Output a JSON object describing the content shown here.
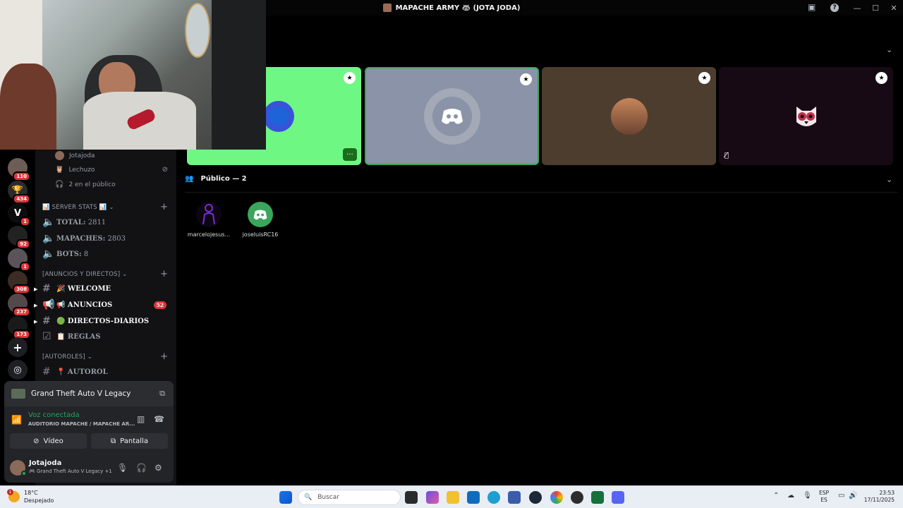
{
  "window": {
    "title": "MAPACHE ARMY 🦝 (JOTA JODA)",
    "minimize": "—",
    "maximize": "☐",
    "close": "✕",
    "help": "?",
    "inbox": "▣"
  },
  "servers": [
    {
      "name": "server-1",
      "badge": "110",
      "color": "#6d5d55"
    },
    {
      "name": "server-2",
      "badge": "434",
      "color": "#2b2b2b"
    },
    {
      "name": "server-3",
      "badge": "1",
      "color": "#0d0d0d",
      "glyph": "V"
    },
    {
      "name": "server-4",
      "badge": "92",
      "color": "#222"
    },
    {
      "name": "server-5",
      "badge": "1",
      "color": "#5a5458"
    },
    {
      "name": "server-6",
      "badge": "308",
      "color": "#3b2d23"
    },
    {
      "name": "server-7",
      "badge": "237",
      "color": "#54494a"
    },
    {
      "name": "server-8",
      "badge": "173",
      "color": "#1a1a1a"
    }
  ],
  "rail_actions": {
    "add": "+",
    "discover": "◎"
  },
  "voice_users": [
    {
      "name": "Jotajoda"
    },
    {
      "name": "Lechuzo",
      "icon": "🦉"
    }
  ],
  "public_count_label": "2 en el público",
  "categories": {
    "server_stats": "📊 SERVER STATS 📊",
    "anuncios": "[ANUNCIOS Y DIRECTOS]",
    "autoroles": "[AUTOROLES]"
  },
  "stats": [
    {
      "label": "TOTAL:",
      "value": "2811"
    },
    {
      "label": "MAPACHES:",
      "value": "2803"
    },
    {
      "label": "BOTS:",
      "value": "8"
    }
  ],
  "channels": [
    {
      "name": "🎉 WELCOME",
      "bold": true
    },
    {
      "name": "📢 ANUNCIOS",
      "bold": true,
      "badge": "52"
    },
    {
      "name": "🟢 DIRECTOS-DIARIOS",
      "bold": true
    },
    {
      "name": "📋 REGLAS",
      "bold": false
    },
    {
      "name": "📍 AUTOROL",
      "bold": false
    }
  ],
  "activity": {
    "game": "Grand Theft Auto V Legacy"
  },
  "voice_status": {
    "status": "Voz conectada",
    "channel": "AUDITORIO MAPACHE / MAPACHE AR..."
  },
  "buttons": {
    "video": "Vídeo",
    "screen": "Pantalla"
  },
  "user": {
    "name": "Jotajoda",
    "status": "🎮 Grand Theft Auto V Legacy +1"
  },
  "stage_tiles": [
    {
      "bg": "#6ff784"
    },
    {
      "bg": "#8a93a7"
    },
    {
      "bg": "#4d3d2f"
    },
    {
      "bg": "#170a14"
    }
  ],
  "public_section": {
    "title": "Público — 2"
  },
  "audience": [
    {
      "name": "marcelojesus..."
    },
    {
      "name": "joseluisRC16"
    }
  ],
  "taskbar": {
    "temp": "18°C",
    "weather": "Despejado",
    "weather_alert": "1",
    "search": "Buscar",
    "lang_top": "ESP",
    "lang_bottom": "ES",
    "time": "23:53",
    "date": "17/11/2025"
  }
}
